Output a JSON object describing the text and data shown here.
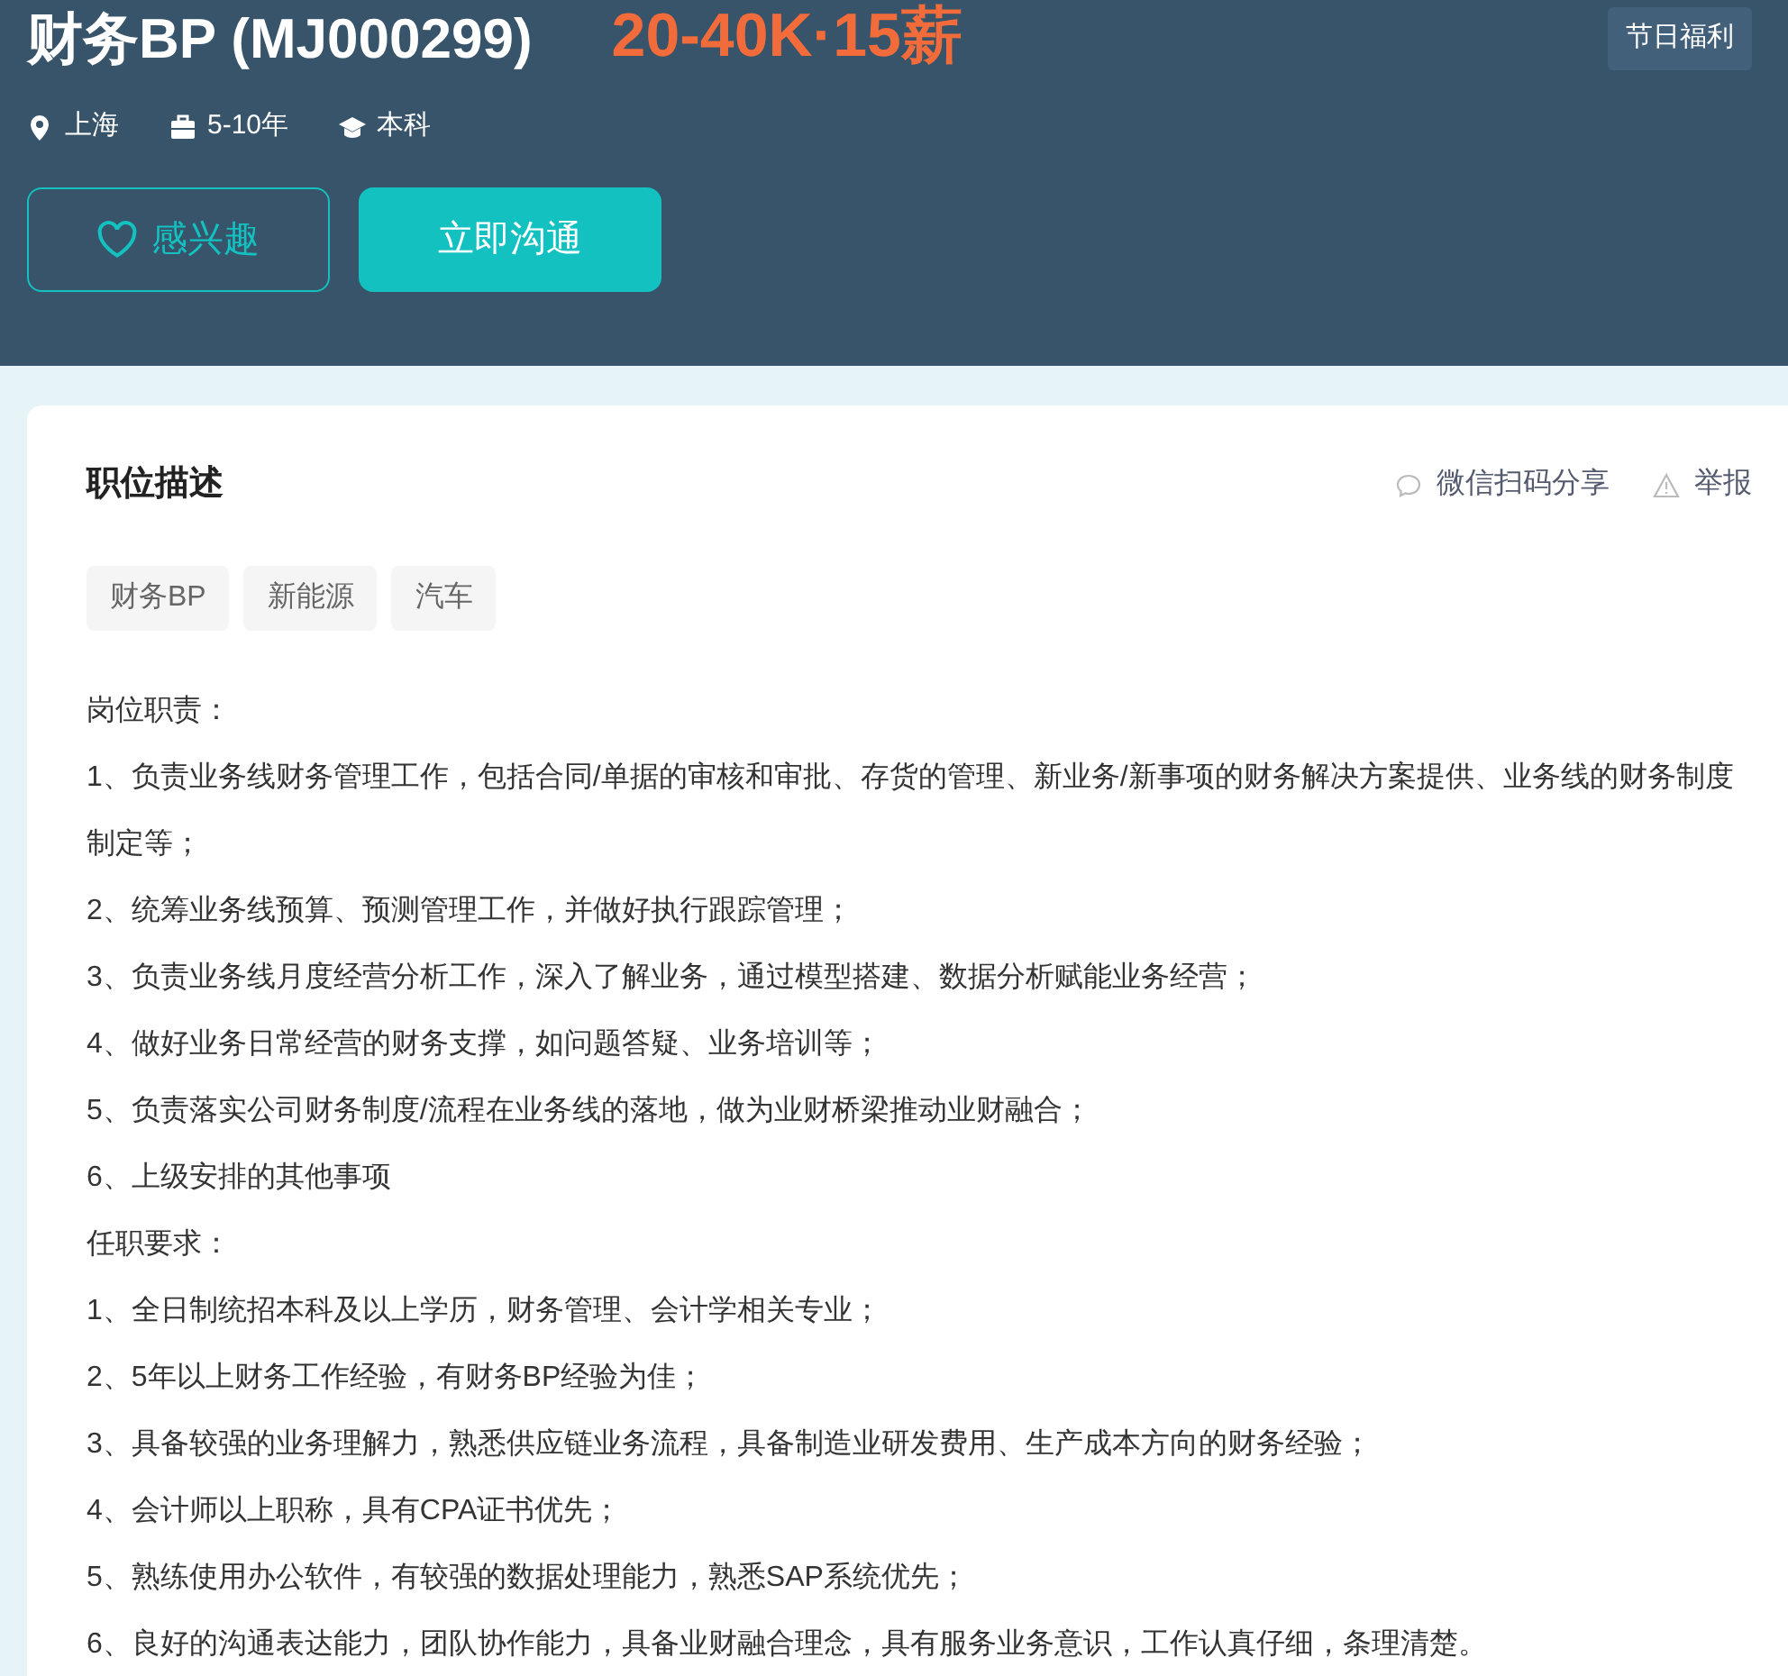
{
  "job": {
    "title": "财务BP (MJ000299)",
    "salary": "20-40K·15薪",
    "meta": [
      {
        "kind": "location",
        "text": "上海"
      },
      {
        "kind": "experience",
        "text": "5-10年"
      },
      {
        "kind": "education",
        "text": "本科"
      }
    ],
    "benefits": [
      "节日福利"
    ],
    "buttons": [
      {
        "kind": "interest",
        "label": "感兴趣"
      },
      {
        "kind": "chat",
        "label": "立即沟通"
      }
    ]
  },
  "description": {
    "heading": "职位描述",
    "actions": [
      {
        "kind": "share",
        "label": "微信扫码分享"
      },
      {
        "kind": "report",
        "label": "举报"
      }
    ],
    "tags": [
      "财务BP",
      "新能源",
      "汽车"
    ],
    "lines": [
      "岗位职责：",
      "1、负责业务线财务管理工作，包括合同/单据的审核和审批、存货的管理、新业务/新事项的财务解决方案提供、业务线的财务制度制定等；",
      "2、统筹业务线预算、预测管理工作，并做好执行跟踪管理；",
      "3、负责业务线月度经营分析工作，深入了解业务，通过模型搭建、数据分析赋能业务经营；",
      "4、做好业务日常经营的财务支撑，如问题答疑、业务培训等；",
      "5、负责落实公司财务制度/流程在业务线的落地，做为业财桥梁推动业财融合；",
      "6、上级安排的其他事项",
      "任职要求：",
      "1、全日制统招本科及以上学历，财务管理、会计学相关专业；",
      "2、5年以上财务工作经验，有财务BP经验为佳；",
      "3、具备较强的业务理解力，熟悉供应链业务流程，具备制造业研发费用、生产成本方向的财务经验；",
      "4、会计师以上职称，具有CPA证书优先；",
      "5、熟练使用办公软件，有较强的数据处理能力，熟悉SAP系统优先；",
      "6、良好的沟通表达能力，团队协作能力，具备业财融合理念，具有服务业务意识，工作认真仔细，条理清楚。"
    ]
  }
}
